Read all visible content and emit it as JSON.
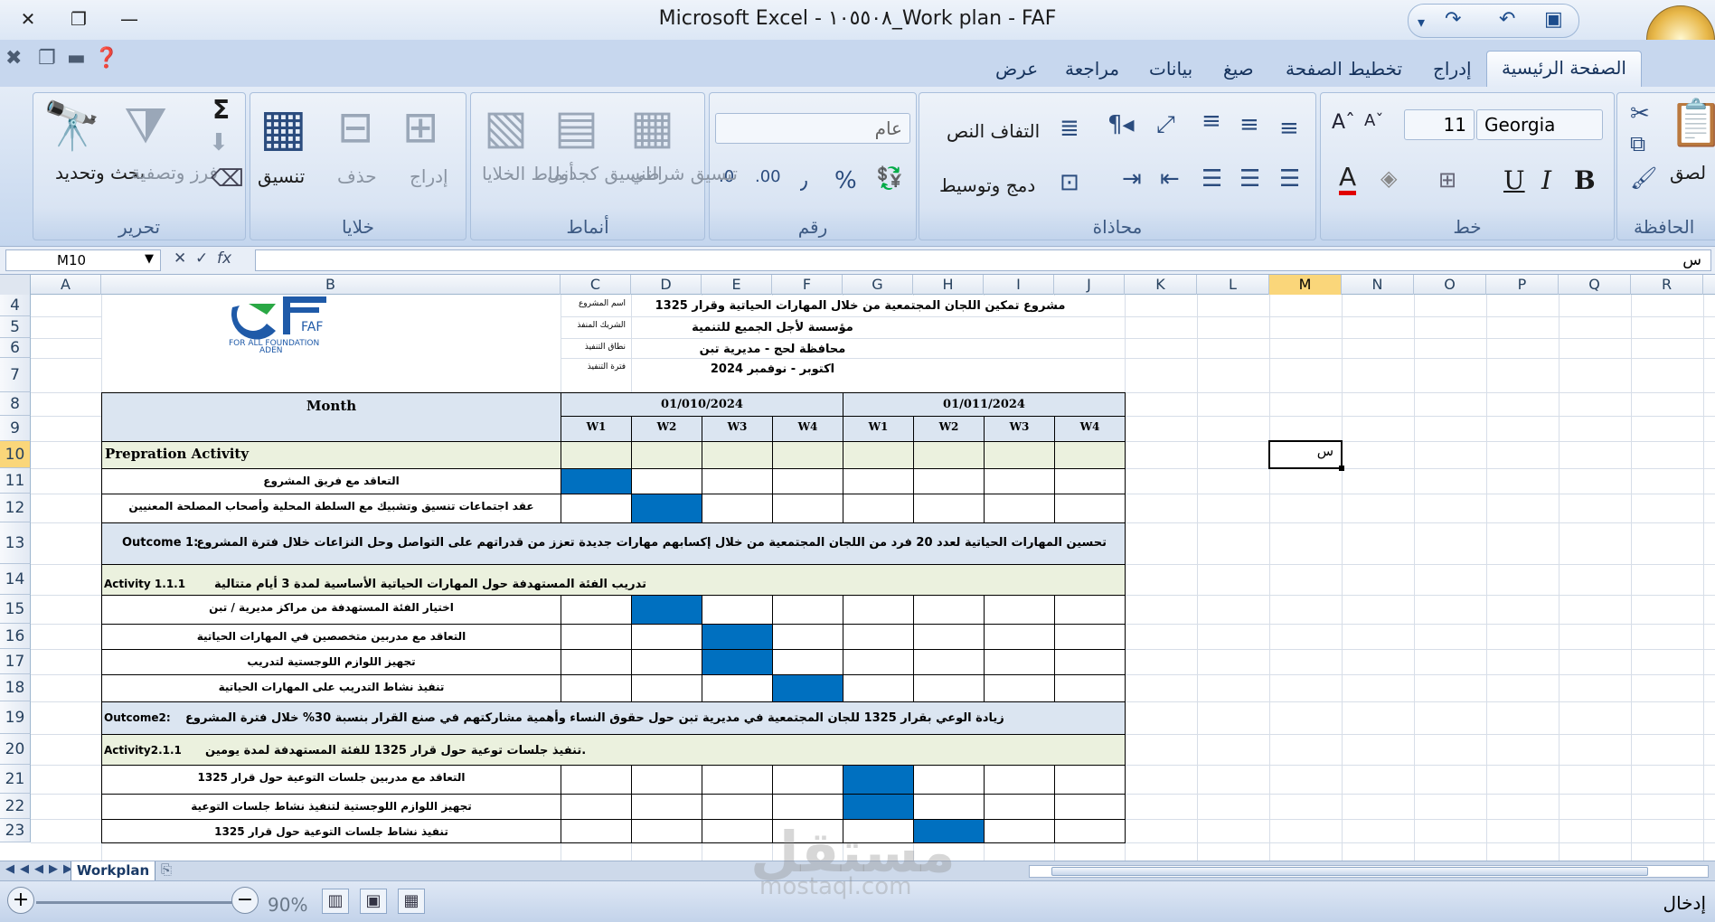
{
  "window": {
    "title": "Microsoft Excel - ١٠٥٥٠٨_Work plan - FAF"
  },
  "tabs": [
    "الصفحة الرئيسية",
    "إدراج",
    "تخطيط الصفحة",
    "صيغ",
    "بيانات",
    "مراجعة",
    "عرض"
  ],
  "ribbon": {
    "clipboard": {
      "paste": "لصق",
      "group": "الحافظة"
    },
    "font": {
      "name": "Georgia",
      "size": "11",
      "bold": "B",
      "italic": "I",
      "underline": "U",
      "group": "خط"
    },
    "alignment": {
      "wrap": "التفاف النص",
      "merge": "دمج وتوسيط",
      "group": "محاذاة"
    },
    "number": {
      "format": "عام",
      "percent": "%",
      "comma": "٫",
      "group": "رقم"
    },
    "styles": {
      "conditional": "تنسيق شرطي",
      "as_table": "التنسيق كجدول",
      "cell_styles": "أنماط الخلايا",
      "group": "أنماط"
    },
    "cells": {
      "insert": "إدراج",
      "delete": "حذف",
      "format": "تنسيق",
      "group": "خلايا"
    },
    "editing": {
      "sort": "فرز وتصفية",
      "find": "بحث وتحديد",
      "sum": "Σ",
      "group": "تحرير"
    }
  },
  "formula_bar": {
    "name_box": "M10",
    "fx": "fx",
    "value": "س"
  },
  "columns": [
    "A",
    "B",
    "C",
    "D",
    "E",
    "F",
    "G",
    "H",
    "I",
    "J",
    "K",
    "L",
    "M",
    "N",
    "O",
    "P",
    "Q",
    "R"
  ],
  "rows": [
    "4",
    "5",
    "6",
    "7",
    "8",
    "9",
    "10",
    "11",
    "12",
    "13",
    "14",
    "15",
    "16",
    "17",
    "18",
    "19",
    "20",
    "21",
    "22",
    "23"
  ],
  "selected_cell_text": "س",
  "logo": {
    "text1": "FAF",
    "text2": "FOR ALL FOUNDATION",
    "text3": "ADEN"
  },
  "info": [
    {
      "label": "اسم المشروع",
      "value": "مشروع تمكين اللجان المجتمعية من خلال المهارات الحياتية وقرار 1325"
    },
    {
      "label": "الشريك المنفذ",
      "value": "مؤسسة لأجل الجميع للتنمية"
    },
    {
      "label": "نطاق التنفيذ",
      "value": "محافظة لحج - مديرية تبن"
    },
    {
      "label": "فترة التنفيذ",
      "value": "اكتوبر - نوفمبر 2024"
    }
  ],
  "table": {
    "month_label": "Month",
    "months": [
      "01/010/2024",
      "01/011/2024"
    ],
    "weeks": [
      "W1",
      "W2",
      "W3",
      "W4",
      "W1",
      "W2",
      "W3",
      "W4"
    ],
    "prep": "Prepration Activity",
    "rows": [
      {
        "text": "التعاقد مع فريق المشروع",
        "weeks": [
          1
        ]
      },
      {
        "text": "عقد اجتماعات تنسيق وتشبيك مع السلطة المحلية وأصحاب المصلحة المعنيين",
        "weeks": [
          2
        ]
      },
      {
        "text": "اختيار الفئة المستهدفة من مراكز مديرية / تبن",
        "weeks": [
          2
        ]
      },
      {
        "text": "التعاقد مع مدربين متخصصين في المهارات الحياتية",
        "weeks": [
          3
        ]
      },
      {
        "text": "تجهيز اللوازم اللوجستية لتدريب",
        "weeks": [
          3
        ]
      },
      {
        "text": "تنفيذ نشاط التدريب على المهارات الحياتية",
        "weeks": [
          4
        ]
      },
      {
        "text": "التعاقد مع مدربين جلسات التوعية حول قرار 1325",
        "weeks": [
          5
        ]
      },
      {
        "text": "تجهيز اللوازم اللوجستية لتنفيذ نشاط جلسات التوعية",
        "weeks": [
          5
        ]
      },
      {
        "text": "تنفيذ نشاط جلسات التوعية حول قرار 1325",
        "weeks": [
          6
        ]
      }
    ],
    "outcome1_label": "Outcome 1:",
    "outcome1": "تحسين المهارات الحياتية لعدد 20 فرد من اللجان المجتمعية من خلال إكسابهم مهارات جديدة تعزز من قدراتهم على التواصل وحل النزاعات خلال فترة المشروع",
    "activity1_label": "Activity 1.1.1",
    "activity1": "تدريب الفئة المستهدفة حول المهارات الحياتية الأساسية لمدة 3 أيام متتالية",
    "outcome2_label": "Outcome2:",
    "outcome2": "زيادة الوعي بقرار 1325 للجان المجتمعية في مديرية تبن حول حقوق النساء وأهمية مشاركتهم في صنع القرار بنسبة 30% خلال فترة المشروع",
    "activity2_label": "Activity2.1.1",
    "activity2": "تنفيذ جلسات توعية حول قرار 1325 للفئة المستهدفة لمدة يومين."
  },
  "sheet_tab": "Workplan",
  "status": {
    "zoom": "90%",
    "mode": "إدخال"
  },
  "watermark": {
    "big": "مستقل",
    "small": "mostaql.com"
  },
  "colors": {
    "fill_blue": "#0070c0",
    "header": "#dbe5f1",
    "green": "#ebf1de",
    "selected_header": "#fad67a"
  }
}
